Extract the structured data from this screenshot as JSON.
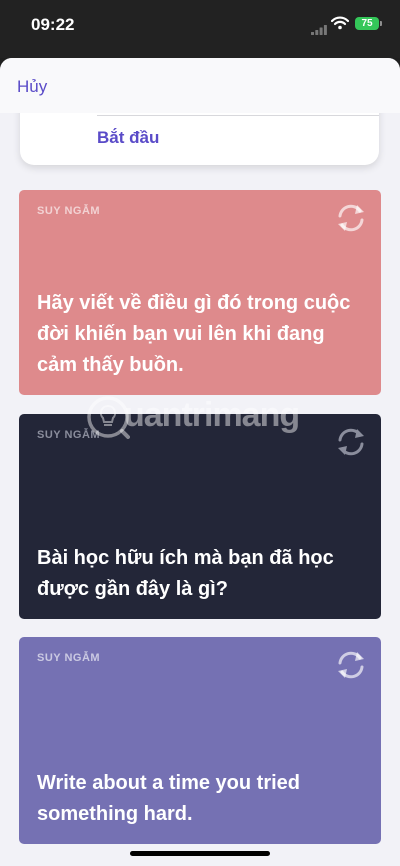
{
  "status_bar": {
    "time": "09:22",
    "battery": "75",
    "icons": [
      "signal-icon",
      "wifi-icon",
      "battery-icon"
    ]
  },
  "nav": {
    "cancel_label": "Hủy"
  },
  "start_card": {
    "start_label": "Bắt đầu"
  },
  "cards": [
    {
      "category": "SUY NGẪM",
      "text": "Hãy viết về điều gì đó trong cuộc đời khiến bạn vui lên khi đang cảm thấy buồn.",
      "color": "#de8a8c",
      "icon": "refresh-icon"
    },
    {
      "category": "SUY NGẪM",
      "text": "Bài học hữu ích mà bạn đã học được gần đây là gì?",
      "color": "#232638",
      "icon": "refresh-icon"
    },
    {
      "category": "SUY NGẪM",
      "text": "Write about a time you tried something hard.",
      "color": "#7571b3",
      "icon": "refresh-icon"
    }
  ],
  "watermark": {
    "text": "uantrimang"
  },
  "colors": {
    "accent": "#5a4bc8",
    "battery_green": "#34c759"
  }
}
